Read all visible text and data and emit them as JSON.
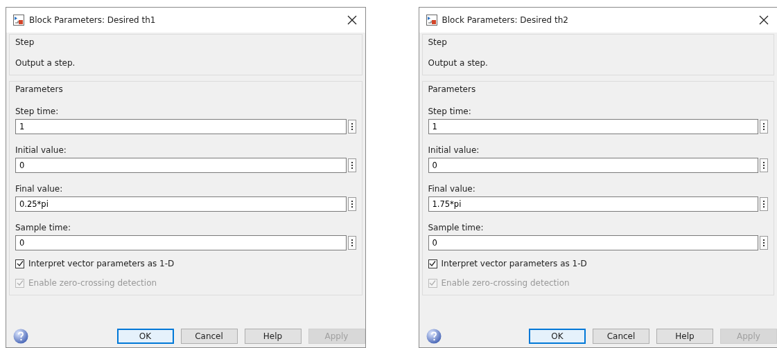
{
  "dialogs": [
    {
      "title": "Block Parameters: Desired th1",
      "block": {
        "legend": "Step",
        "description": "Output a step."
      },
      "parameters": {
        "legend": "Parameters",
        "fields": [
          {
            "label": "Step time:",
            "value": "1"
          },
          {
            "label": "Initial value:",
            "value": "0"
          },
          {
            "label": "Final value:",
            "value": "0.25*pi"
          },
          {
            "label": "Sample time:",
            "value": "0"
          }
        ],
        "checkboxes": [
          {
            "label": "Interpret vector parameters as 1-D",
            "checked": true,
            "disabled": false
          },
          {
            "label": "Enable zero-crossing detection",
            "checked": true,
            "disabled": true
          }
        ]
      },
      "buttons": [
        {
          "label": "OK",
          "default": true,
          "disabled": false
        },
        {
          "label": "Cancel",
          "default": false,
          "disabled": false
        },
        {
          "label": "Help",
          "default": false,
          "disabled": false
        },
        {
          "label": "Apply",
          "default": false,
          "disabled": true
        }
      ]
    },
    {
      "title": "Block Parameters: Desired th2",
      "block": {
        "legend": "Step",
        "description": "Output a step."
      },
      "parameters": {
        "legend": "Parameters",
        "fields": [
          {
            "label": "Step time:",
            "value": "1"
          },
          {
            "label": "Initial value:",
            "value": "0"
          },
          {
            "label": "Final value:",
            "value": "1.75*pi"
          },
          {
            "label": "Sample time:",
            "value": "0"
          }
        ],
        "checkboxes": [
          {
            "label": "Interpret vector parameters as 1-D",
            "checked": true,
            "disabled": false
          },
          {
            "label": "Enable zero-crossing detection",
            "checked": true,
            "disabled": true
          }
        ]
      },
      "buttons": [
        {
          "label": "OK",
          "default": true,
          "disabled": false
        },
        {
          "label": "Cancel",
          "default": false,
          "disabled": false
        },
        {
          "label": "Help",
          "default": false,
          "disabled": false
        },
        {
          "label": "Apply",
          "default": false,
          "disabled": true
        }
      ]
    }
  ]
}
